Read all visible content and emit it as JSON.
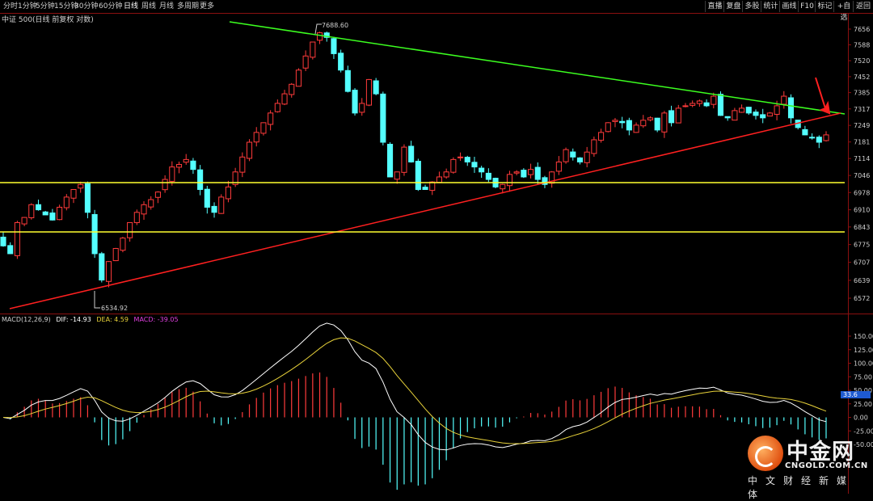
{
  "toolbar": {
    "tabs": [
      {
        "label": "分时"
      },
      {
        "label": "1分钟"
      },
      {
        "label": "5分钟"
      },
      {
        "label": "15分钟"
      },
      {
        "label": "30分钟"
      },
      {
        "label": "60分钟"
      },
      {
        "label": "日线",
        "active": true
      },
      {
        "label": "周线"
      },
      {
        "label": "月线"
      },
      {
        "label": "多周期"
      },
      {
        "label": "更多"
      }
    ],
    "right_buttons": [
      "直播",
      "复盘",
      "多股",
      "统计",
      "画线",
      "F10",
      "标记",
      "+自选",
      "返回"
    ]
  },
  "chart_title": "中证 500(日线 前复权 对数)",
  "price_axis": {
    "ticks": [
      "7656",
      "7588",
      "7520",
      "7452",
      "7385",
      "7317",
      "7249",
      "7181",
      "7114",
      "7046",
      "6978",
      "6910",
      "6843",
      "6775",
      "6707",
      "6639",
      "6572"
    ],
    "log_scale": true
  },
  "annotations": {
    "high": "7688.60",
    "low": "6534.92"
  },
  "macd": {
    "label": "MACD(12,26,9)",
    "dif_text": "DIF: -14.93",
    "dea_text": "DEA: 4.59",
    "macd_text": "MACD: -39.05",
    "ticks": [
      "150.00",
      "125.00",
      "100.00",
      "75.00",
      "50.00",
      "25.00",
      "0.00",
      "-25.00",
      "-50.00"
    ],
    "current_marker": "33.6"
  },
  "colors": {
    "up": "#ff3b3b",
    "down": "#54ffff",
    "support_line": "#ff2020",
    "resistance_line": "#3cff20",
    "horizontal_level": "#ffff30",
    "dif_line": "#ffffff",
    "dea_line": "#e8d23a"
  },
  "watermark": {
    "brand": "中金网",
    "url": "CNGOLD.COM.CN",
    "tagline": "中文财经新媒体"
  }
}
